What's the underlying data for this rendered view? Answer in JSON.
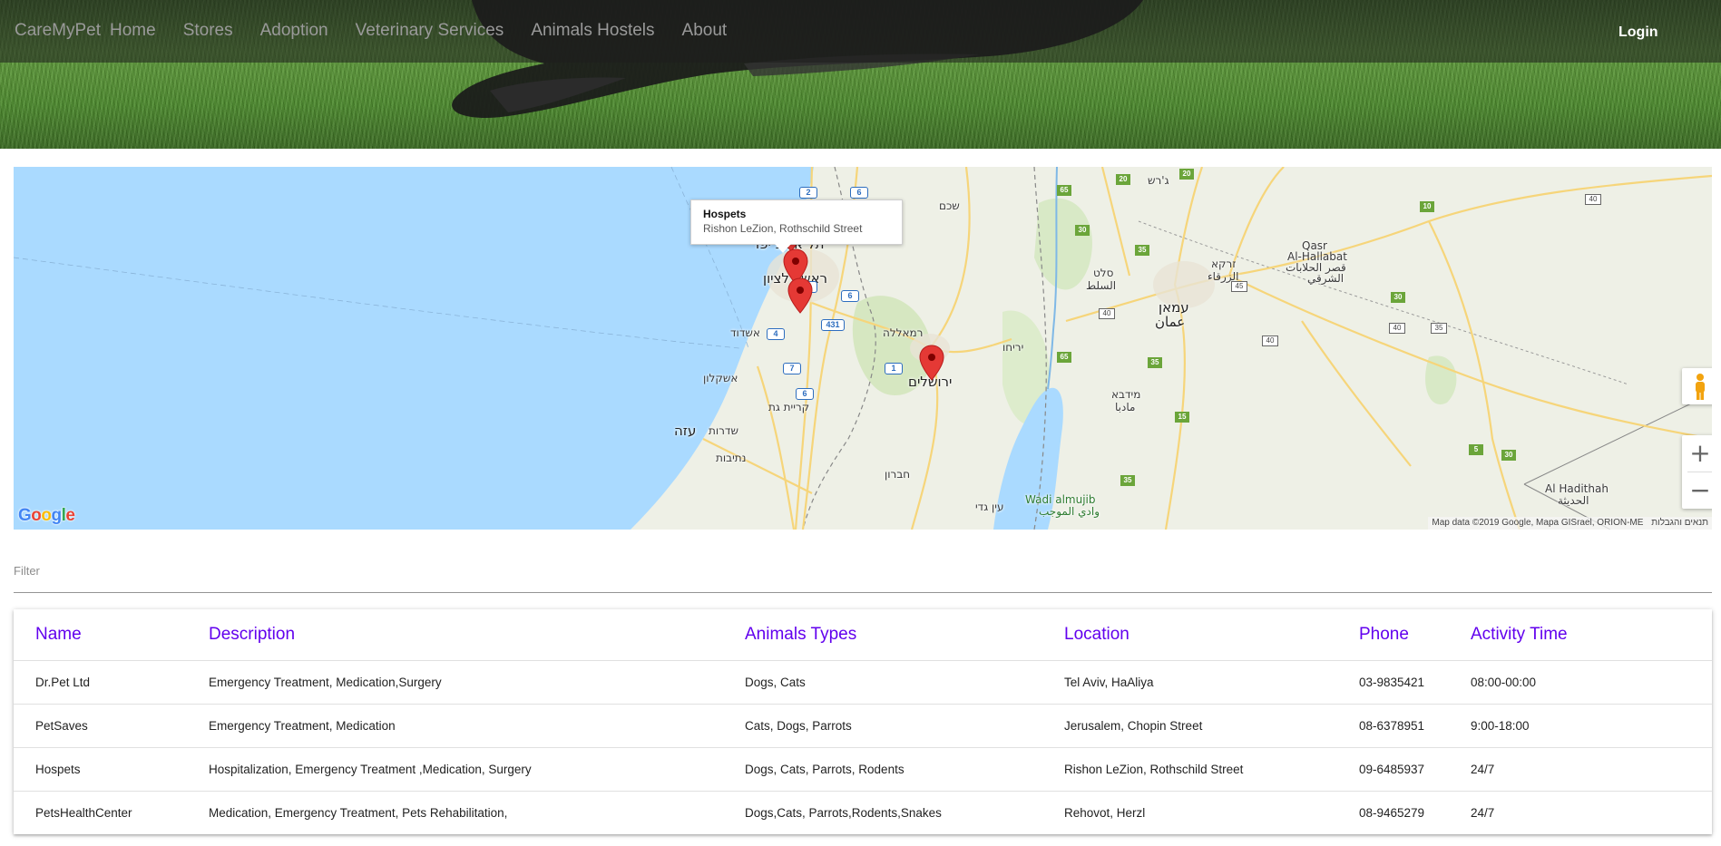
{
  "navbar": {
    "brand": "CareMyPet",
    "links": [
      "Home",
      "Stores",
      "Adoption",
      "Veterinary Services",
      "Animals Hostels",
      "About"
    ],
    "login_label": "Login"
  },
  "map": {
    "info_window": {
      "title": "Hospets",
      "address": "Rishon LeZion, Rothschild Street"
    },
    "cities": {
      "tel_aviv": "תל אביב יפו",
      "rishon": "ראשון לציון",
      "ashdod": "אשדוד",
      "ashkelon": "אשקלון",
      "kiryat_gat": "קריית גת",
      "sderot": "שדרות",
      "gaza": "עזה",
      "netivot": "נתיבות",
      "jerusalem": "ירושלים",
      "ramallah": "רמאללה",
      "jericho": "יריחו",
      "hebron": "חברון",
      "nablus": "שכם",
      "ein_gedi": "עין גדי",
      "salt_he": "סלט",
      "salt_ar": "السلط",
      "amman_he": "עמאן",
      "amman_ar": "عمان",
      "zarqa_he": "זרקא",
      "zarqa_ar": "الزرقاء",
      "madaba_he": "מידבא",
      "madaba_ar": "مادبا",
      "jerash": "ג'רש",
      "qasr_1": "Qasr",
      "qasr_2": "Al-Hallabat",
      "qasr_ar_1": "قصر الحلابات",
      "qasr_ar_2": "الشرقي",
      "wadi_en": "Wadi almujib",
      "wadi_ar": "وادي الموجب",
      "haditha_en": "Al Hadithah",
      "haditha_ar": "الحديثة"
    },
    "routes": {
      "r2": "2",
      "r6a": "6",
      "r1": "1",
      "r6b": "6",
      "r431": "431",
      "r4": "4",
      "r7": "7",
      "r1b": "1",
      "r6c": "6",
      "r65a": "65",
      "r20a": "20",
      "r20b": "20",
      "r30a": "30",
      "r35a": "35",
      "r65b": "65",
      "r35b": "35",
      "r15": "15",
      "r35c": "35",
      "r30b": "30",
      "r30c": "30",
      "r5": "5",
      "r10": "10",
      "r45": "45",
      "r40a": "40",
      "r40b": "40",
      "r40c": "40",
      "r35d": "35",
      "r40d": "40"
    },
    "google_logo": "Google",
    "attribution": "Map data ©2019 Google, Mapa GISrael, ORION-ME",
    "terms": "תנאים והגבלות",
    "zoom_in": "+",
    "zoom_out": "−",
    "pegman_icon": "pegman-icon",
    "marker_color": "#e53935"
  },
  "filter": {
    "label": "Filter",
    "value": ""
  },
  "table": {
    "headers": {
      "name": "Name",
      "description": "Description",
      "animals": "Animals Types",
      "location": "Location",
      "phone": "Phone",
      "activity": "Activity Time"
    },
    "header_color": "#6200ee",
    "rows": [
      {
        "name": "Dr.Pet Ltd",
        "description": "Emergency Treatment, Medication,Surgery",
        "animals": "Dogs, Cats",
        "location": "Tel Aviv, HaAliya",
        "phone": "03-9835421",
        "activity": "08:00-00:00"
      },
      {
        "name": "PetSaves",
        "description": "Emergency Treatment, Medication",
        "animals": "Cats, Dogs, Parrots",
        "location": "Jerusalem, Chopin Street",
        "phone": "08-6378951",
        "activity": "9:00-18:00"
      },
      {
        "name": "Hospets",
        "description": "Hospitalization, Emergency Treatment ,Medication, Surgery",
        "animals": "Dogs, Cats, Parrots, Rodents",
        "location": "Rishon LeZion, Rothschild Street",
        "phone": "09-6485937",
        "activity": "24/7"
      },
      {
        "name": "PetsHealthCenter",
        "description": "Medication, Emergency Treatment, Pets Rehabilitation,",
        "animals": "Dogs,Cats, Parrots,Rodents,Snakes",
        "location": "Rehovot, Herzl",
        "phone": "08-9465279",
        "activity": "24/7"
      }
    ]
  }
}
